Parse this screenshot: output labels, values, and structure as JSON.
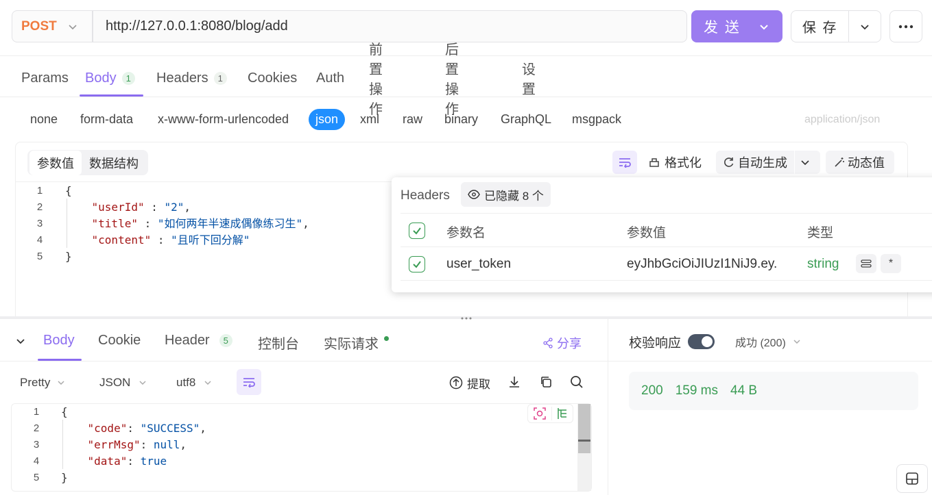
{
  "request": {
    "method": "POST",
    "url": "http://127.0.0.1:8080/blog/add",
    "send_label": "发 送",
    "save_label": "保 存"
  },
  "tabs": [
    {
      "label": "Params"
    },
    {
      "label": "Body",
      "badge": "1"
    },
    {
      "label": "Headers",
      "badge": "1"
    },
    {
      "label": "Cookies"
    },
    {
      "label": "Auth"
    },
    {
      "label": "前置操作"
    },
    {
      "label": "后置操作"
    },
    {
      "label": "设置"
    }
  ],
  "body_types": [
    "none",
    "form-data",
    "x-www-form-urlencoded",
    "json",
    "xml",
    "raw",
    "binary",
    "GraphQL",
    "msgpack"
  ],
  "content_type": "application/json",
  "editor": {
    "segments": [
      "参数值",
      "数据结构"
    ],
    "format_label": "格式化",
    "autogen_label": "自动生成",
    "dynamic_label": "动态值",
    "lines": [
      "1",
      "2",
      "3",
      "4",
      "5"
    ],
    "code": {
      "open": "{",
      "k1": "\"userId\"",
      "v1": "\"2\"",
      "k2": "\"title\"",
      "v2": "\"如何两年半速成偶像练习生\"",
      "k3": "\"content\"",
      "v3": "\"且听下回分解\"",
      "close": "}"
    }
  },
  "headers_popup": {
    "title": "Headers",
    "hidden_label": "已隐藏 8 个",
    "col_name": "参数名",
    "col_value": "参数值",
    "col_type": "类型",
    "row": {
      "name": "user_token",
      "value": "eyJhbGciOiJIUzI1NiJ9.ey.",
      "type": "string"
    }
  },
  "response": {
    "tabs": [
      {
        "label": "Body"
      },
      {
        "label": "Cookie"
      },
      {
        "label": "Header",
        "badge": "5"
      },
      {
        "label": "控制台"
      },
      {
        "label": "实际请求"
      }
    ],
    "share_label": "分享",
    "format": "Pretty",
    "lang": "JSON",
    "encoding": "utf8",
    "extract_label": "提取",
    "lines": [
      "1",
      "2",
      "3",
      "4",
      "5"
    ],
    "code": {
      "open": "{",
      "k1": "\"code\"",
      "v1": "\"SUCCESS\"",
      "k2": "\"errMsg\"",
      "v2": "null",
      "k3": "\"data\"",
      "v3": "true",
      "close": "}"
    }
  },
  "validate": {
    "label": "校验响应",
    "status_select": "成功 (200)",
    "status_code": "200",
    "time": "159 ms",
    "size": "44 B"
  },
  "colors": {
    "accent": "#8b6cf0",
    "brand_method": "#f07b3f",
    "json_chip": "#1f8fff",
    "success": "#3a9c54"
  }
}
